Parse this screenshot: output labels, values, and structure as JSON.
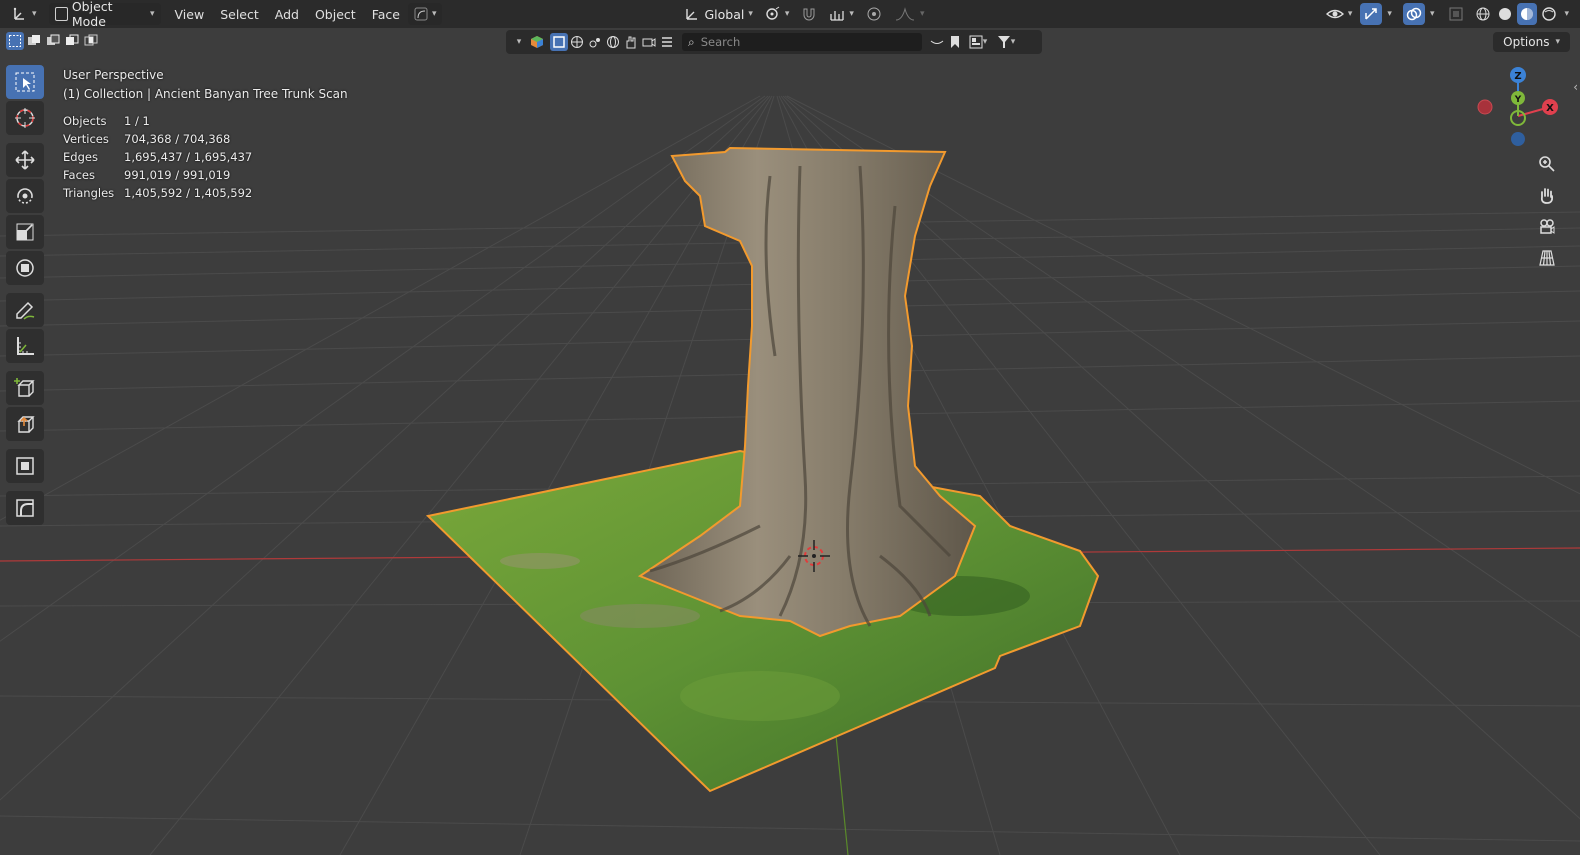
{
  "header": {
    "editor_type_icon": "axis-3d-icon",
    "mode": "Object Mode",
    "menus": [
      "View",
      "Select",
      "Add",
      "Object",
      "Face"
    ],
    "transform_orientation": "Global"
  },
  "outliner_bar": {
    "search_placeholder": "Search"
  },
  "options_label": "Options",
  "overlay": {
    "view_name": "User Perspective",
    "collection": "(1) Collection | Ancient Banyan Tree Trunk Scan"
  },
  "stats": {
    "rows": [
      {
        "label": "Objects",
        "value": "1 / 1"
      },
      {
        "label": "Vertices",
        "value": "704,368 / 704,368"
      },
      {
        "label": "Edges",
        "value": "1,695,437 / 1,695,437"
      },
      {
        "label": "Faces",
        "value": "991,019 / 991,019"
      },
      {
        "label": "Triangles",
        "value": "1,405,592 / 1,405,592"
      }
    ]
  },
  "gizmo": {
    "x": "X",
    "y": "Y",
    "z": "Z"
  },
  "colors": {
    "accent": "#4772b3",
    "selection_outline": "#f29a2e",
    "axis_x": "#e0404e",
    "axis_y": "#7fb83a",
    "axis_z": "#3b82d6",
    "grid": "#4b4b4b",
    "background": "#3d3d3d"
  }
}
